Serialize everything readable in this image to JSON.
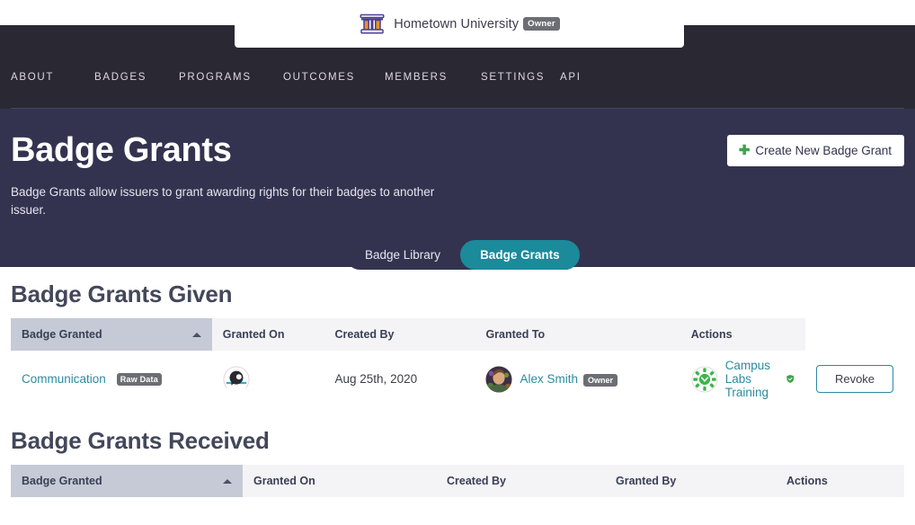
{
  "org": {
    "name": "Hometown University",
    "role_badge": "Owner",
    "logo_icon": "university-columns-icon"
  },
  "nav": {
    "items": [
      {
        "label": "ABOUT",
        "name": "about"
      },
      {
        "label": "BADGES",
        "name": "badges"
      },
      {
        "label": "PROGRAMS",
        "name": "programs"
      },
      {
        "label": "OUTCOMES",
        "name": "outcomes"
      },
      {
        "label": "MEMBERS",
        "name": "members"
      },
      {
        "label": "SETTINGS",
        "name": "settings"
      },
      {
        "label": "API",
        "name": "api"
      }
    ]
  },
  "hero": {
    "title": "Badge Grants",
    "subtitle": "Badge Grants allow issuers to grant awarding rights for their badges to another issuer.",
    "create_button": "Create New Badge Grant",
    "create_icon": "plus-icon"
  },
  "tabs": [
    {
      "label": "Badge Library",
      "active": false
    },
    {
      "label": "Badge Grants",
      "active": true
    }
  ],
  "sections": {
    "given": {
      "title": "Badge Grants Given",
      "columns": [
        "Badge Granted",
        "Granted On",
        "Created By",
        "Granted To",
        "Actions"
      ],
      "sorted_column": "Badge Granted",
      "sort_direction": "asc",
      "rows": [
        {
          "badge_name": "Communication",
          "badge_tag": "Raw Data",
          "badge_icon": "communication-badge-icon",
          "granted_on": "Aug 25th, 2020",
          "created_by": "Alex Smith",
          "created_by_role": "Owner",
          "created_by_avatar": "person-avatar",
          "granted_to": "Campus Labs Training",
          "granted_to_icon": "campus-labs-gear-icon",
          "verified_icon": "green-shield-check-icon",
          "action_label": "Revoke"
        }
      ]
    },
    "received": {
      "title": "Badge Grants Received",
      "columns": [
        "Badge Granted",
        "Granted On",
        "Created By",
        "Granted By",
        "Actions"
      ],
      "sorted_column": "Badge Granted",
      "sort_direction": "asc",
      "rows": []
    }
  },
  "colors": {
    "nav_background": "#2a2833",
    "hero_background": "#333350",
    "accent_teal": "#1b8a9b",
    "link_teal": "#2a8b9e",
    "green": "#3fa34d",
    "sorted_header": "#c5cad6",
    "header_background": "#f4f4f6"
  }
}
